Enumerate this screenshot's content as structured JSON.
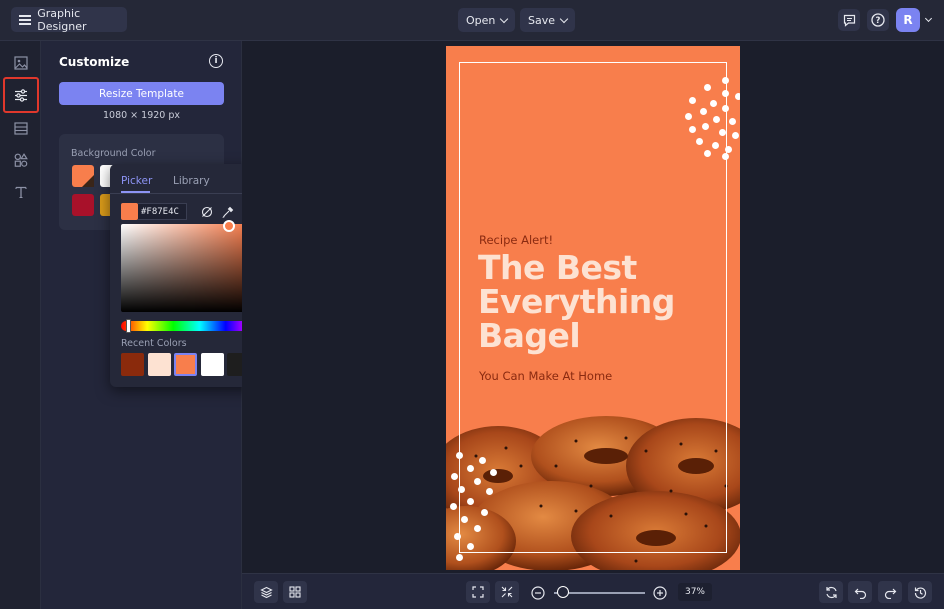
{
  "header": {
    "app_title": "Graphic Designer",
    "open_label": "Open",
    "save_label": "Save",
    "avatar_initial": "R"
  },
  "rail": {
    "items": [
      "image-icon",
      "sliders-icon",
      "layout-icon",
      "shapes-icon",
      "text-icon"
    ],
    "active": "sliders-icon"
  },
  "panel": {
    "title": "Customize",
    "resize_button": "Resize Template",
    "dimensions": "1080 × 1920 px",
    "background_label": "Background Color",
    "swatches": [
      "#f87e4c",
      "#ffffff",
      "#a8112a",
      "#d99a1a"
    ]
  },
  "picker": {
    "tabs": [
      "Picker",
      "Library"
    ],
    "active_tab": "Picker",
    "hex_value": "#F87E4C",
    "current_color": "#f87e4c",
    "recent_label": "Recent Colors",
    "recent_colors": [
      "#8a2a0c",
      "#fde2d2",
      "#f87e4c",
      "#ffffff",
      "#1e1e1e",
      "#fdd6cf"
    ]
  },
  "poster": {
    "background": "#f87e4c",
    "kicker": "Recipe Alert!",
    "headline": [
      "The Best",
      "Everything",
      "Bagel"
    ],
    "subline": "You Can Make At Home"
  },
  "bottom": {
    "zoom": "37%"
  }
}
